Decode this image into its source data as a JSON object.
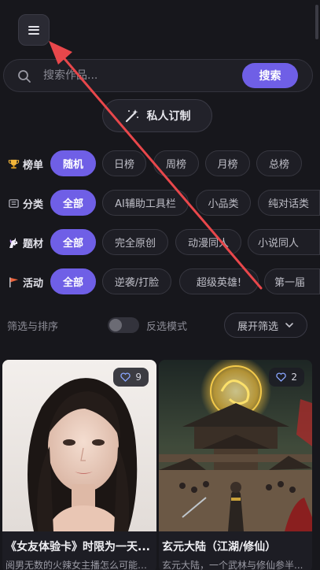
{
  "search": {
    "placeholder": "搜索作品...",
    "button": "搜索"
  },
  "custom_button": "私人订制",
  "rows": [
    {
      "label": "榜单",
      "icon": "trophy-icon",
      "chips": [
        "随机",
        "日榜",
        "周榜",
        "月榜",
        "总榜"
      ],
      "active": 0
    },
    {
      "label": "分类",
      "icon": "category-icon",
      "chips": [
        "全部",
        "AI辅助工具栏",
        "小品类",
        "纯对话类"
      ],
      "active": 0
    },
    {
      "label": "题材",
      "icon": "unicorn-icon",
      "chips": [
        "全部",
        "完全原创",
        "动漫同人",
        "小说同人"
      ],
      "active": 0
    },
    {
      "label": "活动",
      "icon": "flag-icon",
      "chips": [
        "全部",
        "逆袭/打脸",
        "超级英雄!",
        "第一届"
      ],
      "active": 0
    }
  ],
  "filter": {
    "label": "筛选与排序",
    "reverse": "反选模式",
    "expand": "展开筛选"
  },
  "cards": [
    {
      "likes": "9",
      "title": "《女友体验卡》时限为一天...",
      "desc": "阅男无数的火辣女主播怎么可能是..."
    },
    {
      "likes": "2",
      "title": "玄元大陆（江湖/修仙）",
      "desc": "玄元大陆，一个武林与修仙参半..."
    }
  ],
  "colors": {
    "accent": "#6f5fe6",
    "background": "#17171c",
    "annotation_arrow": "#e8474b"
  }
}
